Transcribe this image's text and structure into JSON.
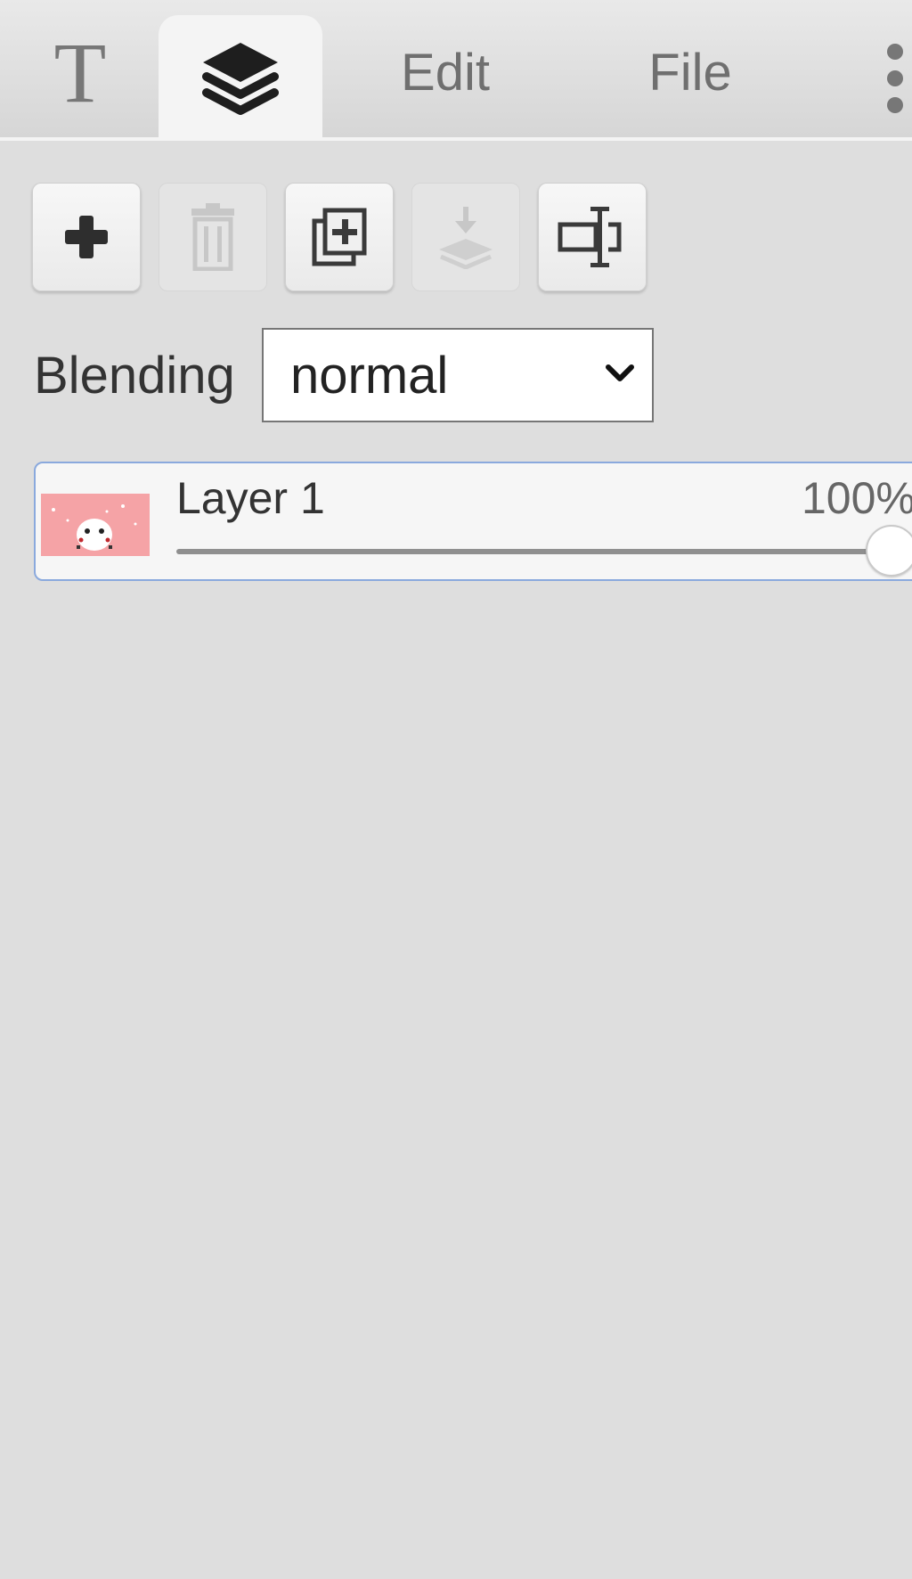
{
  "tabs": {
    "text_glyph": "T",
    "edit_label": "Edit",
    "file_label": "File",
    "active": "layers"
  },
  "toolbar": {
    "buttons": [
      {
        "icon": "plus-icon",
        "enabled": true
      },
      {
        "icon": "trash-icon",
        "enabled": false
      },
      {
        "icon": "duplicate-icon",
        "enabled": true
      },
      {
        "icon": "merge-down-icon",
        "enabled": false
      },
      {
        "icon": "rename-icon",
        "enabled": true
      }
    ]
  },
  "blending": {
    "label": "Blending",
    "value": "normal"
  },
  "layers": [
    {
      "name": "Layer 1",
      "opacity_label": "100%",
      "opacity": 1.0
    }
  ],
  "colors": {
    "panel_bg": "#dedede",
    "thumbnail_pink": "#f5a3a6",
    "selected_border": "#8aa9dd"
  }
}
